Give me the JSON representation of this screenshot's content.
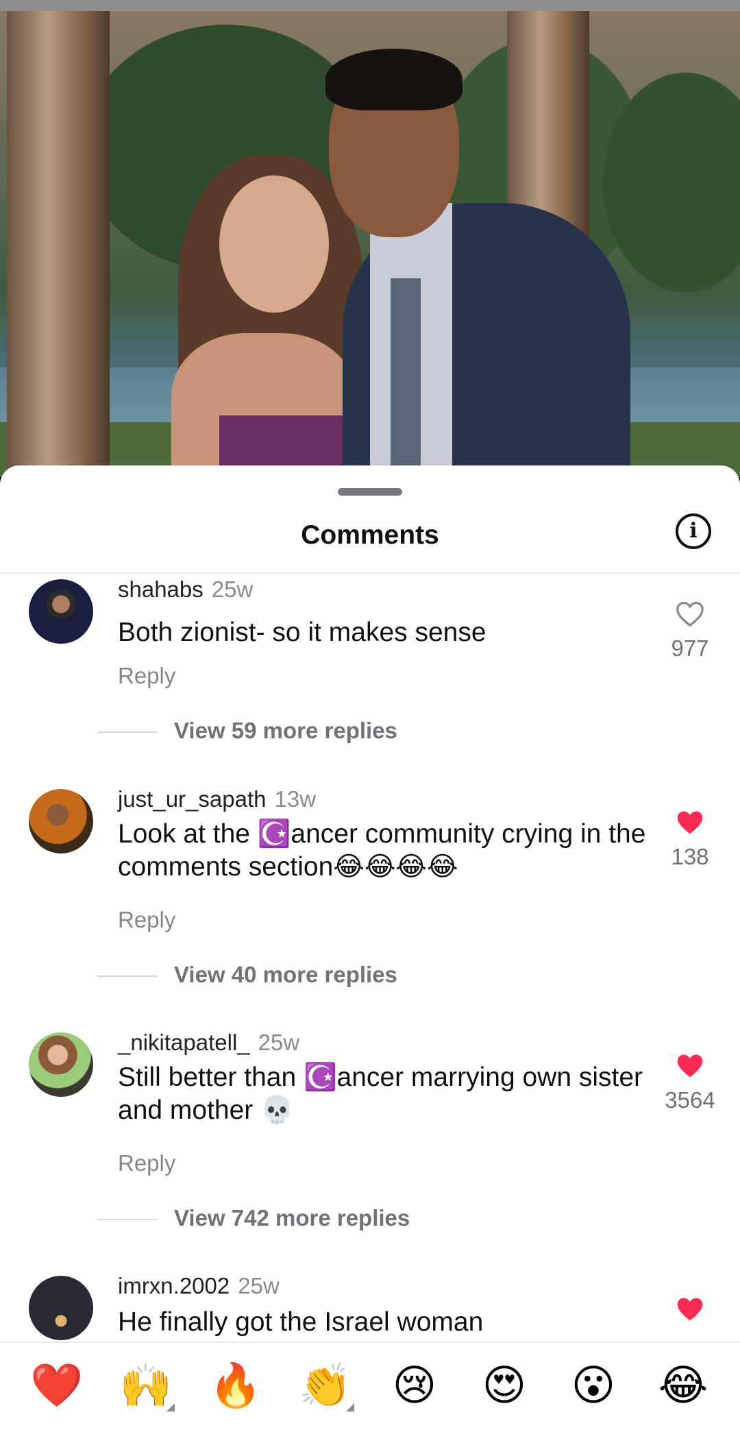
{
  "sheet": {
    "title": "Comments",
    "info_icon_glyph": "i"
  },
  "comments": [
    {
      "username": "shahabs",
      "time": "25w",
      "text": "Both zionist- so it makes sense",
      "reply_label": "Reply",
      "likes": "977",
      "liked": false,
      "more_replies": "View 59 more replies"
    },
    {
      "username": "just_ur_sapath",
      "time": "13w",
      "text": "Look at the ☪️ancer community crying in the comments section😂😂😂😂",
      "reply_label": "Reply",
      "likes": "138",
      "liked": true,
      "more_replies": "View 40 more replies"
    },
    {
      "username": "_nikitapatell_",
      "time": "25w",
      "text": "Still better than ☪️ancer marrying own sister and mother 💀",
      "reply_label": "Reply",
      "likes": "3564",
      "liked": true,
      "more_replies": "View 742 more replies"
    },
    {
      "username": "imrxn.2002",
      "time": "25w",
      "text": "He finally got the Israel woman",
      "liked": true
    }
  ],
  "reactions": [
    "❤️",
    "🙌",
    "🔥",
    "👏",
    "😢",
    "😍",
    "😮",
    "😂"
  ],
  "colors": {
    "liked_heart": "#fe2c55",
    "unliked_heart": "#8a8a8a"
  }
}
